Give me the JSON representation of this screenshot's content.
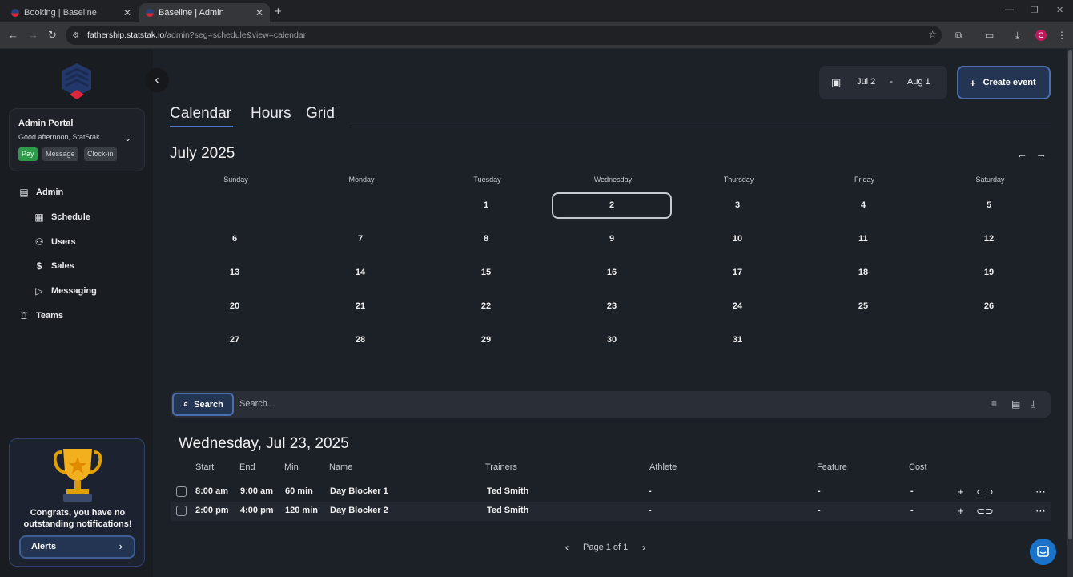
{
  "browser": {
    "tabs": [
      {
        "title": "Booking | Baseline",
        "active": false
      },
      {
        "title": "Baseline | Admin",
        "active": true
      }
    ],
    "url_host": "fathership.statstak.io",
    "url_path": "/admin?seg=schedule&view=calendar",
    "profile_initial": "C"
  },
  "sidebar": {
    "portal_title": "Admin Portal",
    "greeting": "Good afternoon, StatStak",
    "chips": [
      "Pay",
      "Message",
      "Clock-in"
    ],
    "nav": [
      {
        "label": "Admin",
        "icon": "briefcase-icon"
      },
      {
        "label": "Schedule",
        "icon": "calendar-icon"
      },
      {
        "label": "Users",
        "icon": "users-icon"
      },
      {
        "label": "Sales",
        "icon": "dollar-icon"
      },
      {
        "label": "Messaging",
        "icon": "send-icon"
      },
      {
        "label": "Teams",
        "icon": "trophy-icon"
      }
    ],
    "notification_text": "Congrats, you have no outstanding notifications!",
    "alerts_label": "Alerts"
  },
  "header": {
    "date_from": "Jul 2",
    "date_separator": "-",
    "date_to": "Aug 1",
    "create_label": "Create event"
  },
  "view_tabs": [
    "Calendar",
    "Hours",
    "Grid"
  ],
  "calendar": {
    "month_title": "July 2025",
    "weekdays": [
      "Sunday",
      "Monday",
      "Tuesday",
      "Wednesday",
      "Thursday",
      "Friday",
      "Saturday"
    ],
    "weeks": [
      [
        "",
        "",
        "1",
        "2",
        "3",
        "4",
        "5"
      ],
      [
        "6",
        "7",
        "8",
        "9",
        "10",
        "11",
        "12"
      ],
      [
        "13",
        "14",
        "15",
        "16",
        "17",
        "18",
        "19"
      ],
      [
        "20",
        "21",
        "22",
        "23",
        "24",
        "25",
        "26"
      ],
      [
        "27",
        "28",
        "29",
        "30",
        "31",
        "",
        ""
      ]
    ],
    "selected_day": "2"
  },
  "search": {
    "button_label": "Search",
    "placeholder": "Search..."
  },
  "events": {
    "date_heading": "Wednesday, Jul 23, 2025",
    "columns": [
      "Start",
      "End",
      "Min",
      "Name",
      "Trainers",
      "Athlete",
      "Feature",
      "Cost"
    ],
    "rows": [
      {
        "start": "8:00 am",
        "end": "9:00 am",
        "min": "60 min",
        "name": "Day Blocker 1",
        "trainers": "Ted Smith",
        "athlete": "-",
        "feature": "-",
        "cost": "-"
      },
      {
        "start": "2:00 pm",
        "end": "4:00 pm",
        "min": "120 min",
        "name": "Day Blocker 2",
        "trainers": "Ted Smith",
        "athlete": "-",
        "feature": "-",
        "cost": "-"
      }
    ],
    "page_label": "Page 1 of 1"
  },
  "colors": {
    "accent": "#4b6fae",
    "background": "#1c2027",
    "sidebar": "#191c21",
    "pay_chip": "#2d9b4a"
  }
}
